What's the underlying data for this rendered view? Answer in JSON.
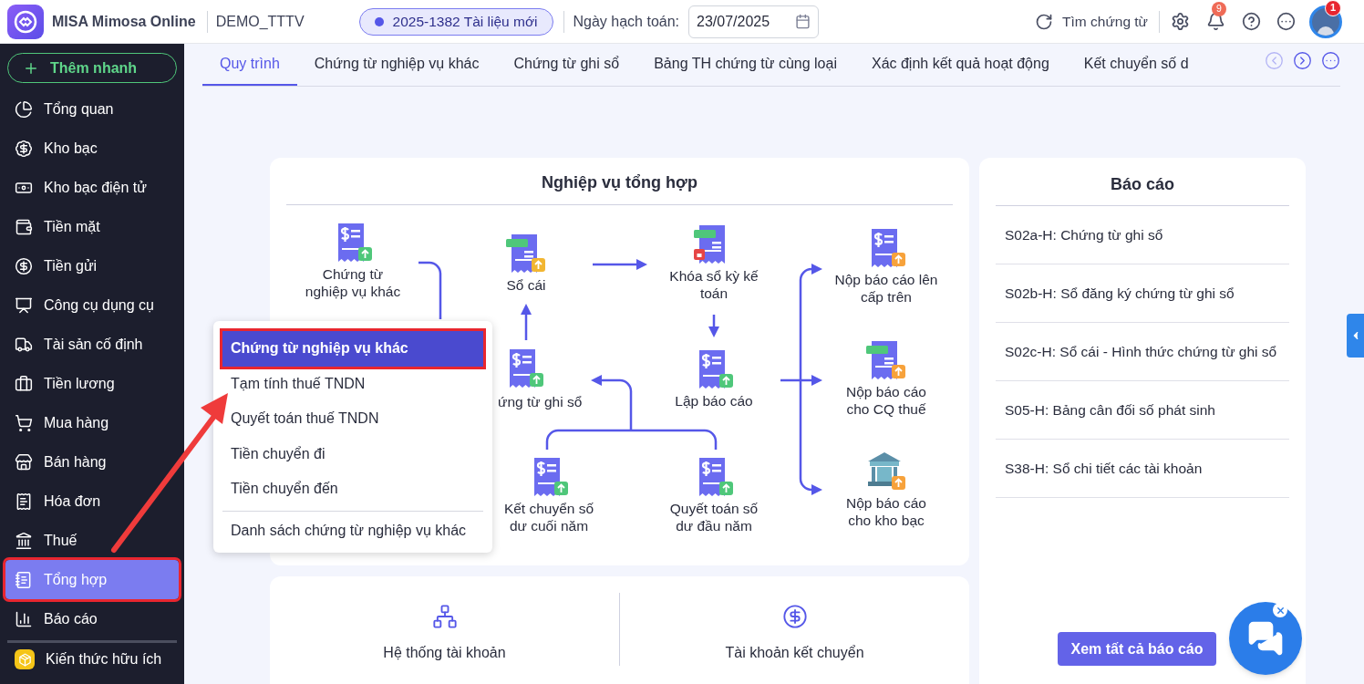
{
  "header": {
    "app_name": "MISA Mimosa Online",
    "workspace": "DEMO_TTTV",
    "document_badge": "2025-1382 Tài liệu mới",
    "date_label": "Ngày hạch toán:",
    "date_value": "23/07/2025",
    "search_label": "Tìm chứng từ",
    "notification_count": "9",
    "avatar_badge": "1"
  },
  "sidebar": {
    "quick_add": "Thêm nhanh",
    "items": [
      {
        "label": "Tổng quan",
        "selected": false,
        "marked": false
      },
      {
        "label": "Kho bạc",
        "selected": false,
        "marked": false
      },
      {
        "label": "Kho bạc điện tử",
        "selected": false,
        "marked": false
      },
      {
        "label": "Tiền mặt",
        "selected": false,
        "marked": false
      },
      {
        "label": "Tiền gửi",
        "selected": false,
        "marked": false
      },
      {
        "label": "Công cụ dụng cụ",
        "selected": false,
        "marked": false
      },
      {
        "label": "Tài sản cố định",
        "selected": false,
        "marked": false
      },
      {
        "label": "Tiền lương",
        "selected": false,
        "marked": false
      },
      {
        "label": "Mua hàng",
        "selected": false,
        "marked": false
      },
      {
        "label": "Bán hàng",
        "selected": false,
        "marked": false
      },
      {
        "label": "Hóa đơn",
        "selected": false,
        "marked": false
      },
      {
        "label": "Thuế",
        "selected": false,
        "marked": false
      },
      {
        "label": "Tổng hợp",
        "selected": true,
        "marked": true
      },
      {
        "label": "Báo cáo",
        "selected": false,
        "marked": false
      }
    ],
    "footer_item": "Kiến thức hữu ích"
  },
  "tabs": [
    {
      "label": "Quy trình",
      "selected": true
    },
    {
      "label": "Chứng từ nghiệp vụ khác",
      "selected": false
    },
    {
      "label": "Chứng từ ghi sổ",
      "selected": false
    },
    {
      "label": "Bảng TH chứng từ cùng loại",
      "selected": false
    },
    {
      "label": "Xác định kết quả hoạt động",
      "selected": false
    },
    {
      "label": "Kết chuyển số d",
      "selected": false
    }
  ],
  "flow_card": {
    "title": "Nghiệp vụ tổng hợp",
    "nodes": [
      {
        "label": "Chứng từ\nnghiệp vụ khác"
      },
      {
        "label": "Sổ cái"
      },
      {
        "label": "Khóa sổ kỳ kế\ntoán"
      },
      {
        "label": "Nộp báo cáo lên\ncấp trên"
      },
      {
        "label": "ứng từ ghi sổ"
      },
      {
        "label": "Lập báo cáo"
      },
      {
        "label": "Nộp báo cáo\ncho CQ thuế"
      },
      {
        "label": "Kết chuyển số\ndư cuối năm"
      },
      {
        "label": "Quyết toán số\ndư đầu năm"
      },
      {
        "label": "Nộp báo cáo\ncho kho bạc"
      }
    ]
  },
  "popup_menu": {
    "items": [
      {
        "label": "Chứng từ nghiệp vụ khác",
        "selected": true,
        "marked": true
      },
      {
        "label": "Tạm tính thuế TNDN",
        "selected": false,
        "marked": false
      },
      {
        "label": "Quyết toán thuế TNDN",
        "selected": false,
        "marked": false
      },
      {
        "label": "Tiền chuyển đi",
        "selected": false,
        "marked": false
      },
      {
        "label": "Tiền chuyển đến",
        "selected": false,
        "marked": false
      }
    ],
    "footer_item": "Danh sách chứng từ nghiệp vụ khác"
  },
  "reports_card": {
    "title": "Báo cáo",
    "items": [
      "S02a-H: Chứng từ ghi sổ",
      "S02b-H: Sổ đăng ký chứng từ ghi sổ",
      "S02c-H: Sổ cái - Hình thức chứng từ ghi sổ",
      "S05-H: Bảng cân đối số phát sinh",
      "S38-H: Sổ chi tiết các tài khoản"
    ],
    "button": "Xem tất cả báo cáo"
  },
  "shortcuts": [
    {
      "label": "Hệ thống tài khoản"
    },
    {
      "label": "Tài khoản kết chuyển"
    }
  ]
}
